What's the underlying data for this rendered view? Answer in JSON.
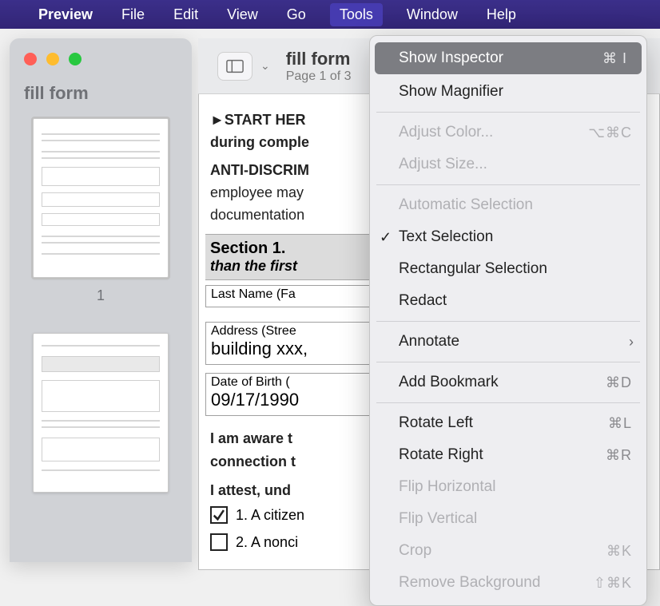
{
  "menubar": {
    "apple": "",
    "items": [
      "Preview",
      "File",
      "Edit",
      "View",
      "Go",
      "Tools",
      "Window",
      "Help"
    ],
    "active_index": 5
  },
  "window": {
    "sidebar_title": "fill form",
    "page_number_1": "1"
  },
  "toolbar": {
    "title": "fill form",
    "subtitle": "Page 1 of 3"
  },
  "doc": {
    "start_here": "►START HER",
    "start_here_sub": "during comple",
    "anti": "ANTI-DISCRIM",
    "anti_sub1": "employee may",
    "anti_sub2": "documentation",
    "section1_title": "Section 1.",
    "section1_sub": "than the first",
    "last_name_label": "Last Name (Fa",
    "address_label": "Address (Stree",
    "address_value": "building xxx,",
    "dob_label": "Date of Birth (",
    "dob_value": "09/17/1990",
    "aware1": "I am aware t",
    "aware2": "connection t",
    "attest": "I attest, und",
    "chk1": "1. A citizen",
    "chk2": "2. A nonci"
  },
  "menu": {
    "show_inspector": "Show Inspector",
    "show_inspector_sc": "⌘ I",
    "show_magnifier": "Show Magnifier",
    "adjust_color": "Adjust Color...",
    "adjust_color_sc": "⌥⌘C",
    "adjust_size": "Adjust Size...",
    "auto_sel": "Automatic Selection",
    "text_sel": "Text Selection",
    "rect_sel": "Rectangular Selection",
    "redact": "Redact",
    "annotate": "Annotate",
    "add_bookmark": "Add Bookmark",
    "add_bookmark_sc": "⌘D",
    "rotate_left": "Rotate Left",
    "rotate_left_sc": "⌘L",
    "rotate_right": "Rotate Right",
    "rotate_right_sc": "⌘R",
    "flip_h": "Flip Horizontal",
    "flip_v": "Flip Vertical",
    "crop": "Crop",
    "crop_sc": "⌘K",
    "remove_bg": "Remove Background",
    "remove_bg_sc": "⇧⌘K"
  }
}
